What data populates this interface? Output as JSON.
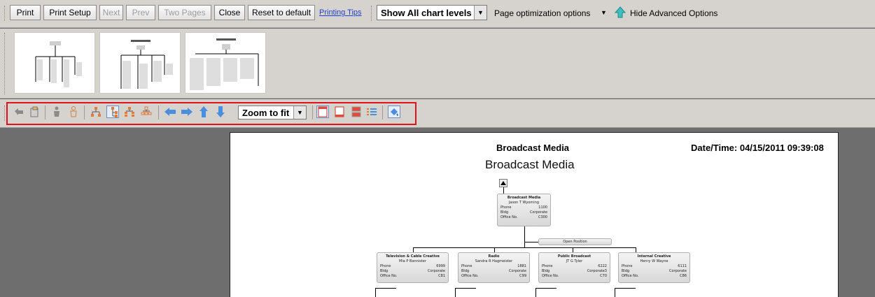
{
  "toolbar": {
    "print": "Print",
    "print_setup": "Print Setup",
    "next": "Next",
    "prev": "Prev",
    "two_pages": "Two Pages",
    "close": "Close",
    "reset": "Reset to default",
    "printing_tips": "Printing Tips",
    "chart_levels": "Show All chart levels",
    "page_optimization": "Page optimization options",
    "hide_advanced": "Hide Advanced Options"
  },
  "toolbar2": {
    "zoom": "Zoom to fit",
    "icons": [
      "undo-icon",
      "paste-icon",
      "person-icon",
      "person-outline-icon",
      "org-tree-icon",
      "org-tree-vertical-icon",
      "org-tree-compact-icon",
      "org-tree-alt-icon",
      "arrow-left-icon",
      "arrow-right-icon",
      "arrow-up-icon",
      "arrow-down-icon",
      "page-portrait-icon",
      "page-landscape-icon",
      "page-stack-icon",
      "list-icon",
      "paint-icon"
    ]
  },
  "page": {
    "header_title": "Broadcast Media",
    "datetime": "Date/Time: 04/15/2011 09:39:08",
    "subtitle": "Broadcast Media",
    "root": {
      "name": "Broadcast Media",
      "person": "Jason T Wyoming",
      "phone_label": "Phone",
      "phone": "1100",
      "bldg_label": "Bldg",
      "bldg": "Corporate",
      "office_label": "Office No.",
      "office": "C300"
    },
    "open_position": "Open Position",
    "children": [
      {
        "name": "Television & Cable Creative",
        "person": "Mia P Bannister",
        "phone_label": "Phone",
        "phone": "6999",
        "bldg_label": "Bldg",
        "bldg": "Corporate",
        "office_label": "Office No.",
        "office": "C81"
      },
      {
        "name": "Radio",
        "person": "Sandra R Hagmeister",
        "phone_label": "Phone",
        "phone": "1881",
        "bldg_label": "Bldg",
        "bldg": "Corporate",
        "office_label": "Office No.",
        "office": "C99"
      },
      {
        "name": "Public Broadcast",
        "person": "JT G Tyler",
        "phone_label": "Phone",
        "phone": "6222",
        "bldg_label": "Bldg",
        "bldg": "Corporate3",
        "office_label": "Office No.",
        "office": "C70"
      },
      {
        "name": "Internal Creative",
        "person": "Henry W Wayne",
        "phone_label": "Phone",
        "phone": "6111",
        "bldg_label": "Bldg",
        "bldg": "Corporate",
        "office_label": "Office No.",
        "office": "C86"
      }
    ]
  }
}
